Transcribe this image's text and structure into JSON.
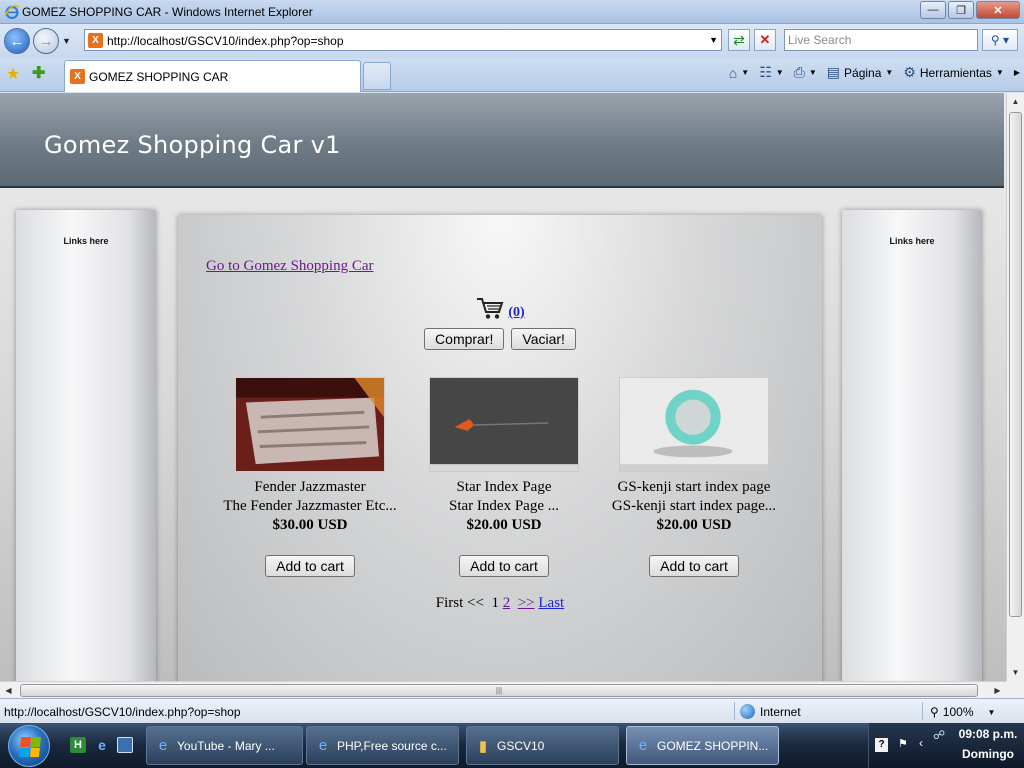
{
  "window": {
    "title": "GOMEZ SHOPPING CAR - Windows Internet Explorer"
  },
  "addressbar": {
    "url": "http://localhost/GSCV10/index.php?op=shop",
    "search_placeholder": "Live Search"
  },
  "tabs": [
    {
      "label": "GOMEZ SHOPPING CAR"
    }
  ],
  "commandbar": {
    "page_label": "Página",
    "tools_label": "Herramientas"
  },
  "page": {
    "site_title": "Gomez Shopping Car v1",
    "left_sidebar_label": "Links here",
    "right_sidebar_label": "Links here",
    "go_link": "Go to Gomez Shopping Car",
    "cart_count": "(0)",
    "buy_button": "Comprar!",
    "empty_button": "Vaciar!",
    "products": [
      {
        "name": "Fender Jazzmaster",
        "description": "The Fender Jazzmaster Etc...",
        "price": "$30.00 USD",
        "button": "Add to cart"
      },
      {
        "name": "Star Index Page",
        "description": "Star Index Page ...",
        "price": "$20.00 USD",
        "button": "Add to cart"
      },
      {
        "name": "GS-kenji start index page",
        "description": "GS-kenji start index page...",
        "price": "$20.00 USD",
        "button": "Add to cart"
      }
    ],
    "pager": {
      "first": "First <<",
      "page1": "1",
      "page2": "2",
      "next": ">>",
      "last": "Last"
    }
  },
  "statusbar": {
    "url": "http://localhost/GSCV10/index.php?op=shop",
    "zone": "Internet",
    "zoom": "100%"
  },
  "taskbar": {
    "tasks": [
      {
        "label": "YouTube - Mary ..."
      },
      {
        "label": "PHP,Free source c..."
      },
      {
        "label": "GSCV10"
      },
      {
        "label": "GOMEZ SHOPPIN..."
      }
    ],
    "time": "09:08 p.m.",
    "day": "Domingo"
  },
  "colors": {
    "header_bg": "#6f7b86",
    "visited_link": "#6a1a8c",
    "link": "#1a24d0",
    "taskbar": "#1b2a40"
  }
}
